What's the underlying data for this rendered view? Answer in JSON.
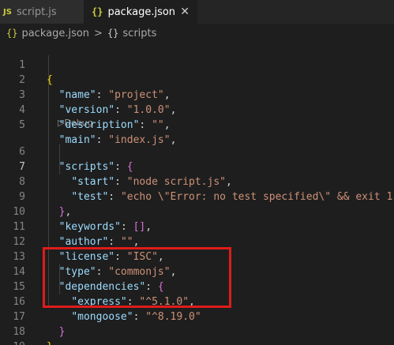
{
  "tabs": [
    {
      "icon": "JS",
      "label": "script.js"
    },
    {
      "icon": "{}",
      "label": "package.json",
      "close": "✕"
    }
  ],
  "breadcrumb": {
    "file_icon": "{}",
    "file": "package.json",
    "separator": ">",
    "section_icon": "{}",
    "section": "scripts"
  },
  "codelens": "▷Debug",
  "lines": [
    {
      "n": "1"
    },
    {
      "n": "2",
      "k": "\"name\"",
      "v": "\"project\""
    },
    {
      "n": "3",
      "k": "\"version\"",
      "v": "\"1.0.0\""
    },
    {
      "n": "4",
      "k": "\"description\"",
      "v": "\"\""
    },
    {
      "n": "5",
      "k": "\"main\"",
      "v": "\"index.js\""
    },
    {
      "n": "6",
      "k": "\"scripts\""
    },
    {
      "n": "7",
      "k": "\"start\"",
      "v": "\"node script.js\""
    },
    {
      "n": "8",
      "k": "\"test\"",
      "v": "\"echo \\\"Error: no test specified\\\" && exit 1\""
    },
    {
      "n": "9"
    },
    {
      "n": "10",
      "k": "\"keywords\"",
      "v": "[]"
    },
    {
      "n": "11",
      "k": "\"author\"",
      "v": "\"\""
    },
    {
      "n": "12",
      "k": "\"license\"",
      "v": "\"ISC\""
    },
    {
      "n": "13",
      "k": "\"type\"",
      "v": "\"commonjs\""
    },
    {
      "n": "14",
      "k": "\"dependencies\""
    },
    {
      "n": "15",
      "k": "\"express\"",
      "v": "\"^5.1.0\""
    },
    {
      "n": "16",
      "k": "\"mongoose\"",
      "v": "\"^8.19.0\""
    },
    {
      "n": "17"
    },
    {
      "n": "18"
    },
    {
      "n": "19"
    }
  ]
}
